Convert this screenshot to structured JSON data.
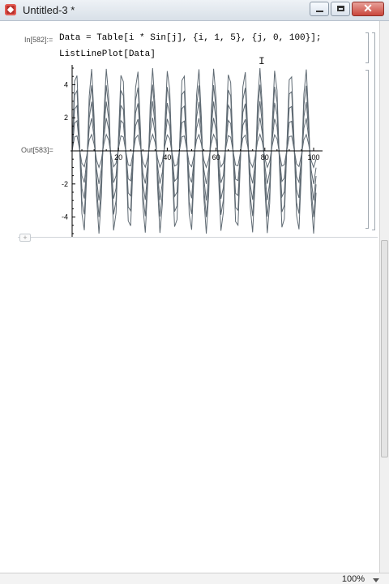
{
  "window": {
    "title": "Untitled-3 *"
  },
  "notebook": {
    "input_label": "In[582]:=",
    "input_lines": [
      "Data = Table[i * Sin[j], {i, 1, 5}, {j, 0, 100}];",
      "ListLinePlot[Data]"
    ],
    "output_label": "Out[583]="
  },
  "chart_data": {
    "type": "line",
    "xlim": [
      0,
      101
    ],
    "ylim": [
      -5,
      5
    ],
    "x_ticks": [
      "20",
      "40",
      "60",
      "80",
      "100"
    ],
    "y_ticks": [
      "4",
      "2",
      "-2",
      "-4"
    ],
    "series_formula": "i * sin(j), j = 0..100, i = 1..5",
    "series": [
      {
        "amplitude": 1
      },
      {
        "amplitude": 2
      },
      {
        "amplitude": 3
      },
      {
        "amplitude": 4
      },
      {
        "amplitude": 5
      }
    ],
    "line_color": "#5f6a73"
  },
  "status": {
    "zoom": "100%"
  }
}
